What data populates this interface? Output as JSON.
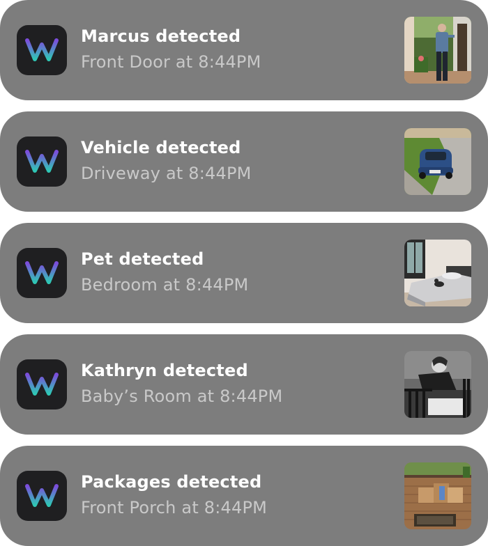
{
  "app": {
    "icon": "wyze-w-logo-icon",
    "logo_gradient": [
      "#7b4ddb",
      "#2fc7b5"
    ]
  },
  "notifications": [
    {
      "title": "Marcus detected",
      "subtitle": "Front Door at 8:44PM",
      "thumbnail": "man-at-front-door-photo"
    },
    {
      "title": "Vehicle detected",
      "subtitle": "Driveway at 8:44PM",
      "thumbnail": "blue-car-in-driveway-photo"
    },
    {
      "title": "Pet detected",
      "subtitle": "Bedroom at 8:44PM",
      "thumbnail": "cat-on-bed-photo"
    },
    {
      "title": "Kathryn detected",
      "subtitle": "Baby’s Room at 8:44PM",
      "thumbnail": "woman-at-crib-photo"
    },
    {
      "title": "Packages detected",
      "subtitle": "Front Porch at 8:44PM",
      "thumbnail": "packages-on-porch-photo"
    }
  ]
}
